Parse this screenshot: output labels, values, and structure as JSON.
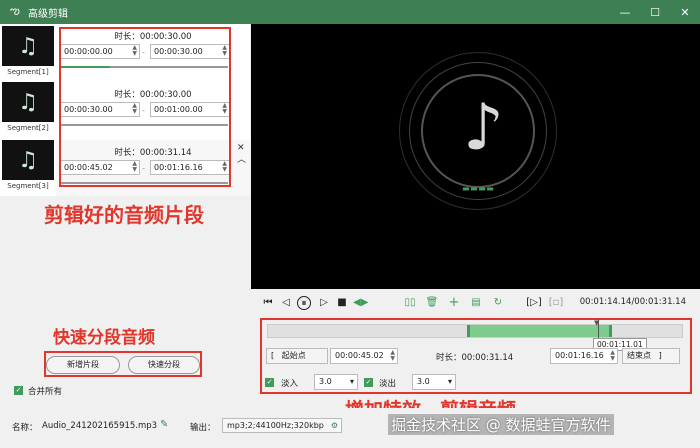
{
  "window": {
    "title": "高级剪辑",
    "logo_glyph": "ఌ",
    "controls": [
      "—",
      "☐",
      "✕"
    ]
  },
  "thumbnails": [
    {
      "label": "Segment[1]",
      "icon": "music-note-icon",
      "glyph": "♫"
    },
    {
      "label": "Segment[2]",
      "icon": "music-note-icon",
      "glyph": "♫"
    },
    {
      "label": "Segment[3]",
      "icon": "music-note-icon",
      "glyph": "♫"
    }
  ],
  "segments": [
    {
      "duration": "时长：00:00:30.00",
      "start": "00:00:00.00",
      "end": "00:00:30.00",
      "progress": 0.3
    },
    {
      "duration": "时长：00:00:30.00",
      "start": "00:00:30.00",
      "end": "00:01:00.00",
      "progress": 0.0
    },
    {
      "duration": "时长：00:00:31.14",
      "start": "00:00:45.02",
      "end": "00:01:16.16",
      "progress": 0.0
    }
  ],
  "segment_dash": "-",
  "segment_controls": {
    "close": "✕",
    "up": "︿"
  },
  "annotations": {
    "segments": "剪辑好的音频片段",
    "split": "快速分段音频",
    "effects": "增加特效，剪辑音频"
  },
  "left_tools": {
    "add_segment": "新增片段",
    "quick_split": "快速分段",
    "merge_all": "合并所有",
    "merge_checked": true
  },
  "player": {
    "icons": [
      "⏮",
      "◁",
      "⏸",
      "▷",
      "■",
      "◀▶",
      "▯▯",
      "🗑",
      "+",
      "▤",
      "↻",
      "[▷]",
      "[▫]"
    ],
    "time": "00:01:14.14/00:01:31.14",
    "eq_glyph": "▬ ▬ ▬ ▬",
    "note_glyph": "♪"
  },
  "timeline": {
    "selection_start": 0.48,
    "selection_end": 0.83,
    "playhead": 0.798,
    "tooltip": "00:01:11.01"
  },
  "trim": {
    "start_label": "起始点",
    "start_bracket": "[",
    "start": "00:00:45.02",
    "duration": "时长：00:00:31.14",
    "end": "00:01:16.16",
    "end_label": "结束点",
    "end_bracket": "]"
  },
  "fade": {
    "in_label": "淡入",
    "in_value": "3.0",
    "out_label": "淡出",
    "out_value": "3.0",
    "in_checked": true,
    "out_checked": true,
    "dropdown": "▾"
  },
  "status": {
    "name_label": "名称：",
    "name": "Audio_241202165915.mp3",
    "output_label": "输出：",
    "output": "mp3;2;44100Hz;320kbp",
    "edit_icon": "✎",
    "settings_icon": "⚙"
  },
  "watermark": "掘金技术社区 @ 数据蛙官方软件",
  "colors": {
    "accent": "#3f9c5b",
    "titlebar": "#3f7f54",
    "annotation": "#e0362b"
  }
}
